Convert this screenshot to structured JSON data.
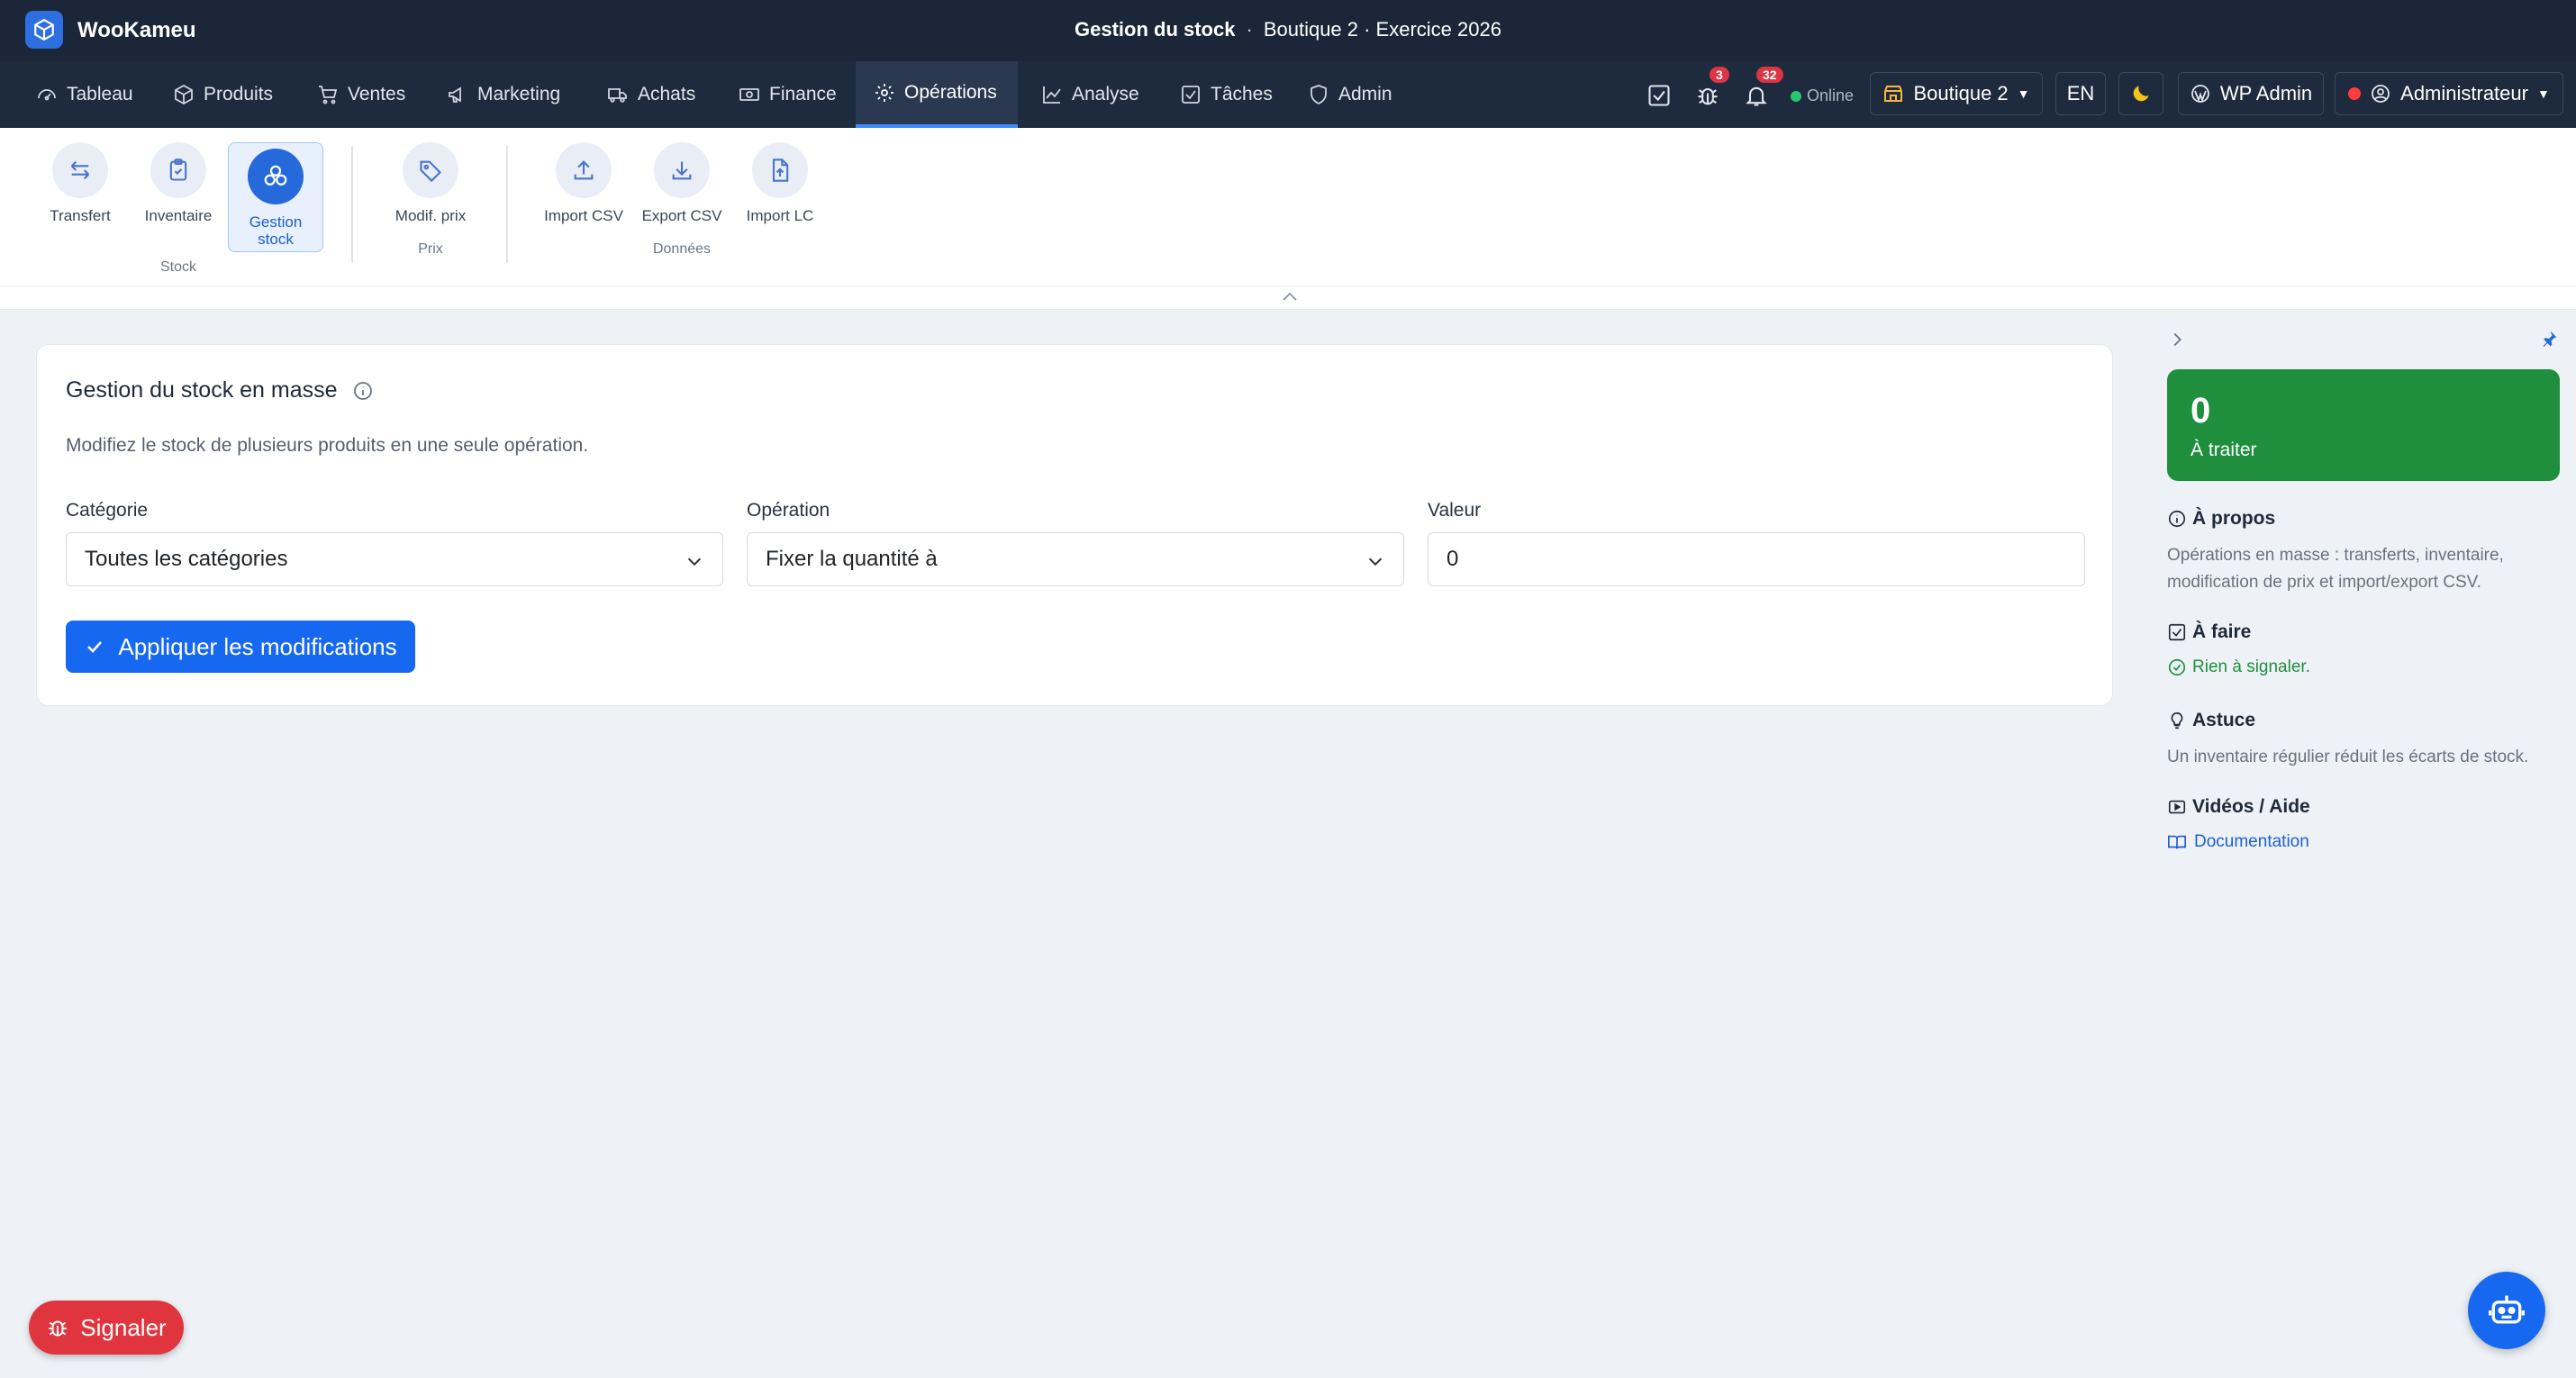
{
  "app": {
    "name": "WooKameu"
  },
  "window_title": {
    "page": "Gestion du stock",
    "sep": "·",
    "context": "Boutique 2 · Exercice 2026"
  },
  "nav": {
    "items": [
      {
        "label": "Tableau"
      },
      {
        "label": "Produits"
      },
      {
        "label": "Ventes"
      },
      {
        "label": "Marketing"
      },
      {
        "label": "Achats"
      },
      {
        "label": "Finance"
      },
      {
        "label": "Opérations"
      },
      {
        "label": "Analyse"
      },
      {
        "label": "Tâches"
      },
      {
        "label": "Admin"
      }
    ],
    "bug_count": "3",
    "notif_count": "32",
    "status": "Online",
    "shop": "Boutique 2",
    "lang": "EN",
    "wp_admin": "WP Admin",
    "user": "Administrateur"
  },
  "ribbon": {
    "items": [
      {
        "label": "Transfert"
      },
      {
        "label": "Inventaire"
      },
      {
        "label": "Gestion stock"
      },
      {
        "label": "Modif. prix"
      },
      {
        "label": "Import CSV"
      },
      {
        "label": "Export CSV"
      },
      {
        "label": "Import LC"
      }
    ],
    "groups": {
      "stock": "Stock",
      "prix": "Prix",
      "donnees": "Données"
    }
  },
  "card": {
    "title": "Gestion du stock en masse",
    "description": "Modifiez le stock de plusieurs produits en une seule opération.",
    "category_label": "Catégorie",
    "category_value": "Toutes les catégories",
    "operation_label": "Opération",
    "operation_value": "Fixer la quantité à",
    "value_label": "Valeur",
    "value_value": "0",
    "apply_label": "Appliquer les modifications"
  },
  "side": {
    "count": "0",
    "count_label": "À traiter",
    "about_title": "À propos",
    "about_text": "Opérations en masse : transferts, inventaire, modification de prix et import/export CSV.",
    "todo_title": "À faire",
    "todo_text": "Rien à signaler.",
    "tip_title": "Astuce",
    "tip_text": "Un inventaire régulier réduit les écarts de stock.",
    "videos_title": "Vidéos / Aide",
    "doc_link": "Documentation"
  },
  "report_label": "Signaler",
  "colors": {
    "accent": "#1668f0",
    "nav_bg": "#1e2a3d",
    "success": "#1f8f3d",
    "danger": "#e0353f"
  }
}
